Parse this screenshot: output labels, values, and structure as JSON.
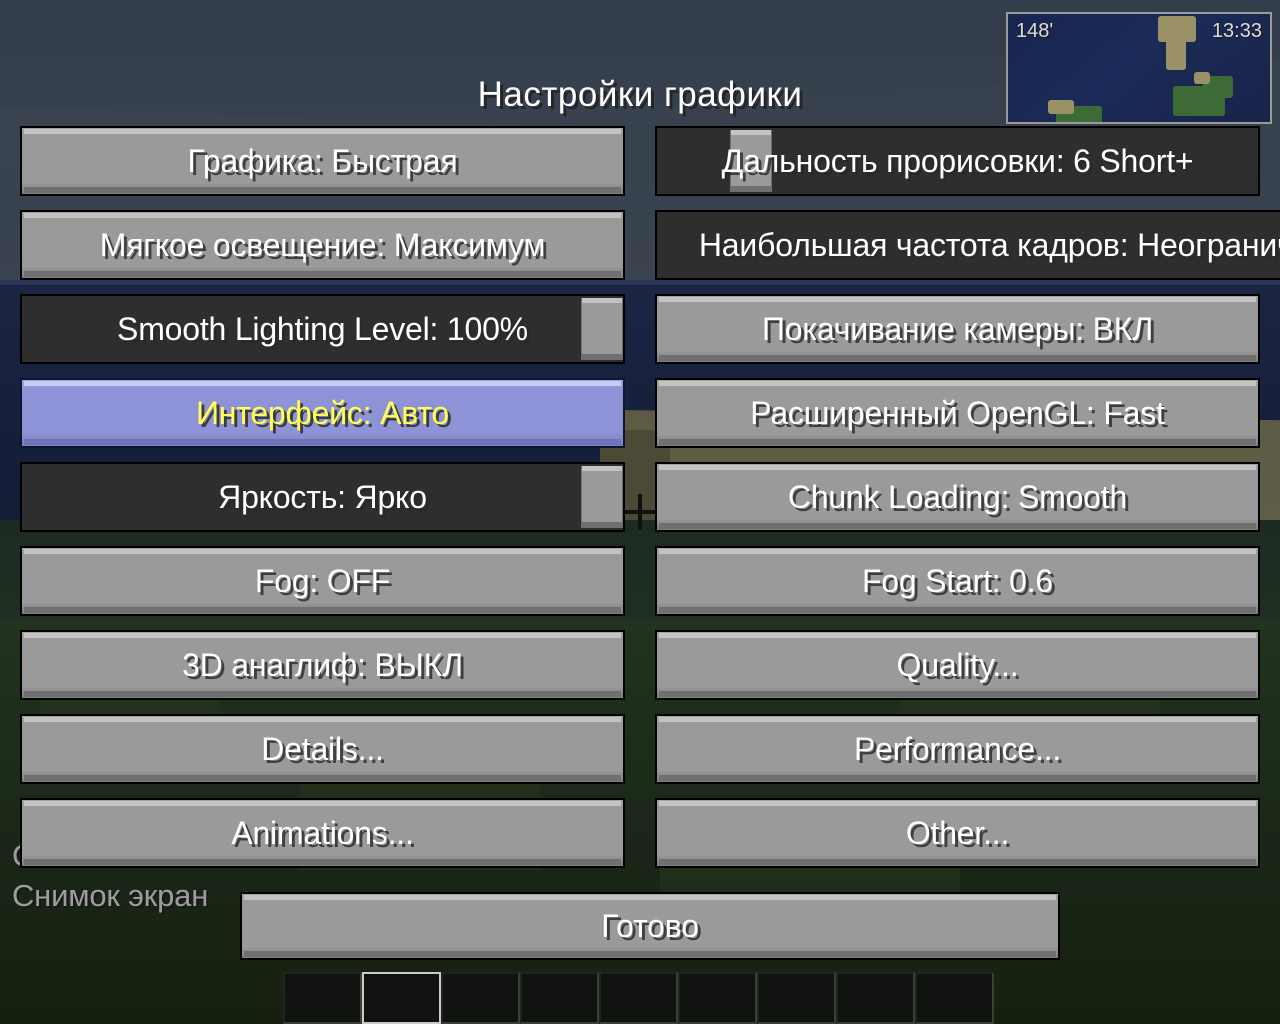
{
  "screen": {
    "title": "Настройки графики"
  },
  "hud": {
    "minimap": {
      "altitude": "148'",
      "time": "13:33"
    },
    "toast_line_1": "С",
    "toast_line_2": "Снимок экран",
    "hotbar_slot_count": 9,
    "selected_slot_index": 1
  },
  "left_column": [
    {
      "label": "Графика: Быстрая",
      "type": "button",
      "state": "normal"
    },
    {
      "label": "Мягкое освещение: Максимум",
      "type": "button",
      "state": "normal"
    },
    {
      "label": "Smooth Lighting Level: 100%",
      "type": "slider",
      "state": "normal",
      "fill": 100
    },
    {
      "label": "Интерфейс: Авто",
      "type": "button",
      "state": "hovered"
    },
    {
      "label": "Яркость: Ярко",
      "type": "slider",
      "state": "normal",
      "fill": 100
    },
    {
      "label": "Fog: OFF",
      "type": "button",
      "state": "normal"
    },
    {
      "label": "3D анаглиф: ВЫКЛ",
      "type": "button",
      "state": "normal"
    },
    {
      "label": "Details...",
      "type": "button",
      "state": "normal"
    },
    {
      "label": "Animations...",
      "type": "button",
      "state": "normal"
    }
  ],
  "right_column": [
    {
      "label": "Дальность прорисовки: 6 Short+",
      "type": "slider",
      "state": "normal",
      "fill": 13
    },
    {
      "label": "Наибольшая частота кадров: Неограниче",
      "type": "slider",
      "state": "normal",
      "fill": 100
    },
    {
      "label": "Покачивание камеры: ВКЛ",
      "type": "button",
      "state": "normal"
    },
    {
      "label": "Расширенный OpenGL: Fast",
      "type": "button",
      "state": "normal"
    },
    {
      "label": "Chunk Loading: Smooth",
      "type": "button",
      "state": "normal"
    },
    {
      "label": "Fog Start: 0.6",
      "type": "button",
      "state": "normal"
    },
    {
      "label": "Quality...",
      "type": "button",
      "state": "normal"
    },
    {
      "label": "Performance...",
      "type": "button",
      "state": "normal"
    },
    {
      "label": "Other...",
      "type": "button",
      "state": "normal"
    }
  ],
  "done_button": {
    "label": "Готово"
  },
  "colors": {
    "button_face": "#9a9a9a",
    "button_highlight": "#c3c3c3",
    "button_shadow": "#6f6f6f",
    "slider_track": "#2e2e2e",
    "hovered_face": "#8e93d8",
    "hovered_text": "#ffff55",
    "text": "#ffffff",
    "sky": "#38414e",
    "water": "#1b2442",
    "grass": "#22331f",
    "sand": "#5d5b43",
    "minimap_water": "#1a2550",
    "minimap_land": "#3d6b35"
  }
}
